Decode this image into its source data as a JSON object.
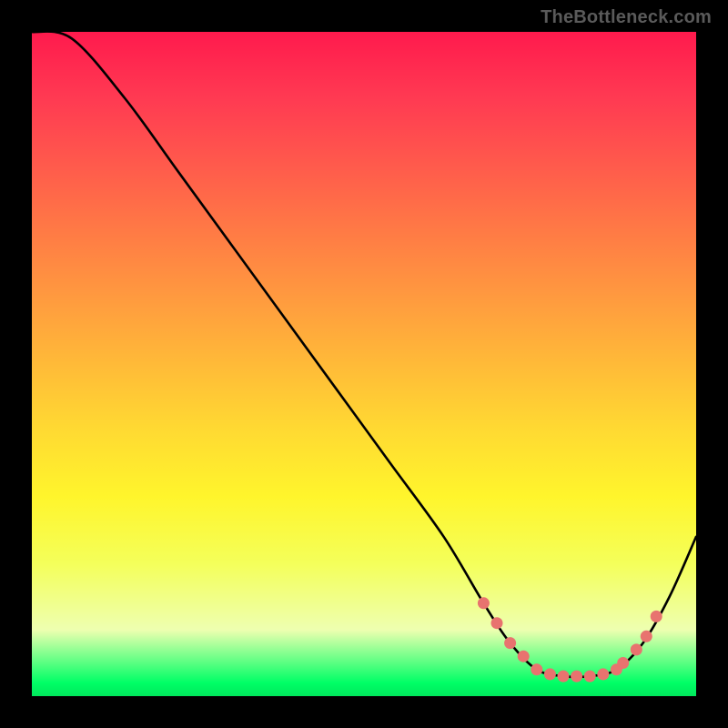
{
  "watermark": "TheBottleneck.com",
  "chart_data": {
    "type": "line",
    "title": "",
    "xlabel": "",
    "ylabel": "",
    "xlim": [
      0,
      100
    ],
    "ylim": [
      0,
      100
    ],
    "series": [
      {
        "name": "bottleneck-curve",
        "x": [
          0,
          6,
          14,
          22,
          30,
          38,
          46,
          54,
          62,
          68,
          72,
          76,
          80,
          84,
          88,
          92,
          96,
          100
        ],
        "y": [
          100,
          99,
          90,
          79,
          68,
          57,
          46,
          35,
          24,
          14,
          8,
          4,
          3,
          3,
          4,
          8,
          15,
          24
        ]
      }
    ],
    "markers": {
      "name": "highlight-dots",
      "color": "#e8736f",
      "x": [
        68,
        70,
        72,
        74,
        76,
        78,
        80,
        82,
        84,
        86,
        88,
        89,
        91,
        92.5,
        94
      ],
      "y": [
        14,
        11,
        8,
        6,
        4,
        3.3,
        3,
        3,
        3,
        3.3,
        4,
        5,
        7,
        9,
        12
      ]
    }
  }
}
